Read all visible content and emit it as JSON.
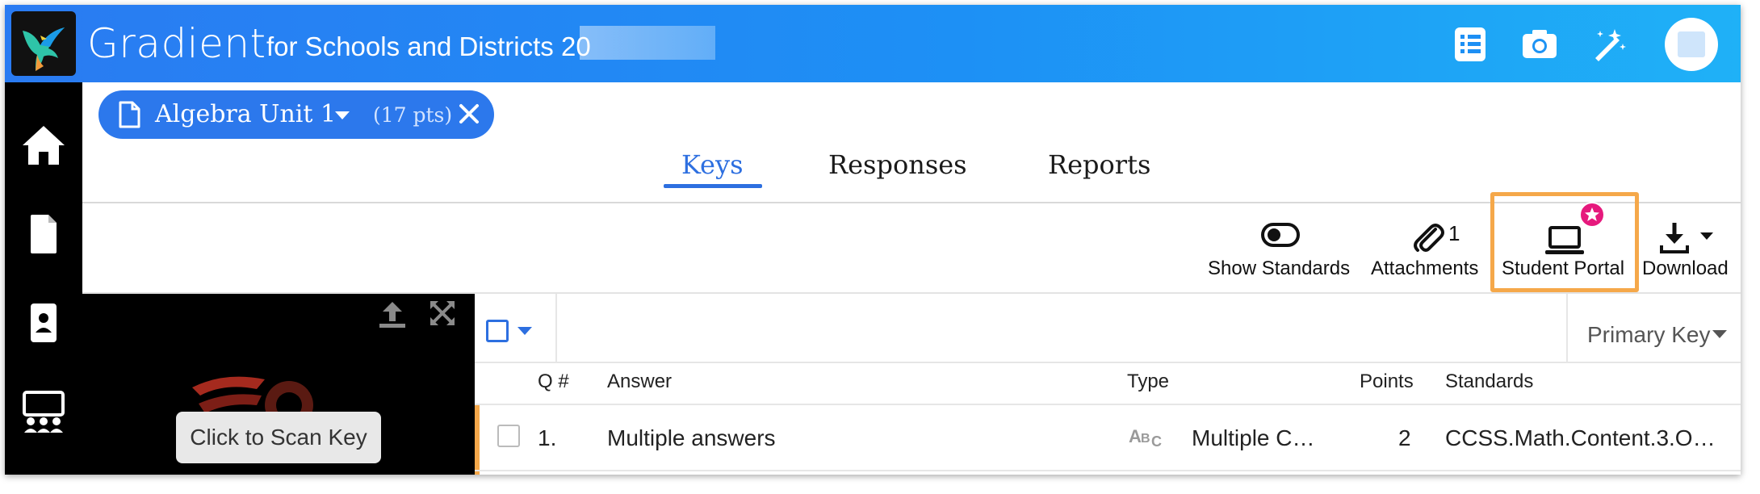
{
  "header": {
    "brand": "Gradient",
    "subtitle": "for Schools and Districts 20"
  },
  "assignment": {
    "title": "Algebra Unit 1",
    "points": "(17 pts)"
  },
  "tabs": [
    {
      "label": "Keys",
      "active": true
    },
    {
      "label": "Responses",
      "active": false
    },
    {
      "label": "Reports",
      "active": false
    }
  ],
  "toolbar": {
    "show_standards": "Show Standards",
    "attachments": "Attachments",
    "attachments_count": "1",
    "student_portal": "Student Portal",
    "download": "Download"
  },
  "scan": {
    "button": "Click to Scan Key"
  },
  "keys_table": {
    "key_select": "Primary Key",
    "columns": [
      "Q #",
      "Answer",
      "Type",
      "Points",
      "Standards"
    ],
    "rows": [
      {
        "q": "1.",
        "answer": "Multiple answers",
        "type": "Multiple C…",
        "points": "2",
        "standards": "CCSS.Math.Content.3.O…"
      }
    ]
  },
  "colors": {
    "header_start": "#2a7bf2",
    "header_end": "#1fb1f7",
    "accent": "#2d6fe0",
    "highlight": "#f5a84a",
    "badge": "#e6197d"
  }
}
